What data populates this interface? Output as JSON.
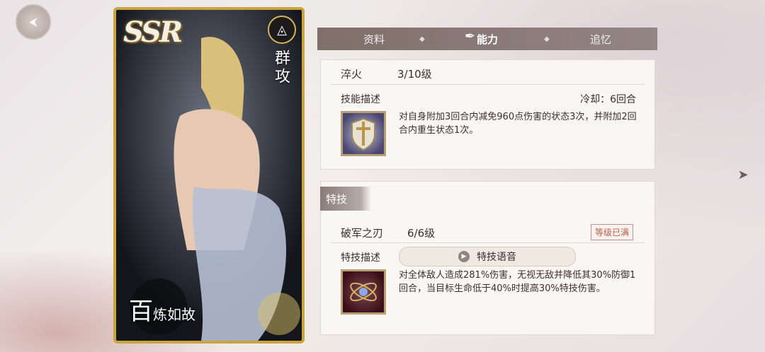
{
  "card": {
    "rarity": "SSR",
    "type_label": "群攻",
    "type_icon": "triangle-sigil-icon",
    "name_first": "百",
    "name_rest": "炼如故"
  },
  "tabs": [
    {
      "label": "资料",
      "active": false
    },
    {
      "label": "能力",
      "active": true
    },
    {
      "label": "追忆",
      "active": false
    }
  ],
  "skill": {
    "name": "淬火",
    "level": "3/10级",
    "desc_label": "技能描述",
    "cooldown": "冷却：6回合",
    "description": "对自身附加3回合内减免960点伤害的状态3次，并附加2回合内重生状态1次。",
    "icon": "sword-shield-icon"
  },
  "special": {
    "section_label": "特技",
    "name": "破军之刃",
    "level": "6/6级",
    "max_badge": "等级已满",
    "desc_label": "特技描述",
    "voice_button": "特技语音",
    "description": "对全体敌人造成281%伤害，无视无敌并降低其30%防御1回合，当目标生命低于40%时提高30%特技伤害。",
    "icon": "orbit-crystal-icon"
  }
}
